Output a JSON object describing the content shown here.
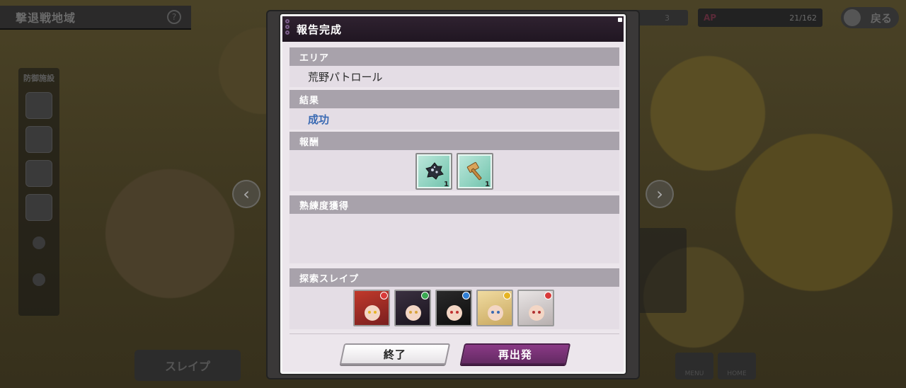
{
  "background": {
    "area_title": "撃退戦地域",
    "defense_label": "防御施設",
    "ap_label": "AP",
    "ap_value": "21/162",
    "back_label": "戻る",
    "search_count": "3",
    "slave_button": "スレイプ",
    "menu_label": "MENU",
    "home_label": "HOME"
  },
  "dialog": {
    "title": "報告完成",
    "sections": {
      "area": {
        "label": "エリア",
        "value": "荒野パトロール"
      },
      "result": {
        "label": "結果",
        "value": "成功"
      },
      "reward": {
        "label": "報酬",
        "items": [
          {
            "icon": "ore-icon",
            "qty": "1"
          },
          {
            "icon": "hammer-icon",
            "qty": "1"
          }
        ]
      },
      "proficiency": {
        "label": "熟練度獲得"
      },
      "slaves": {
        "label": "探索スレイプ",
        "members": [
          {
            "badge_color": "#d83a3a",
            "hair": "#c0392b",
            "eye": "#e6b422"
          },
          {
            "badge_color": "#3aa852",
            "hair": "#2a2230",
            "eye": "#d8a33a"
          },
          {
            "badge_color": "#2f7fd6",
            "hair": "#1a1a1a",
            "eye": "#c03030"
          },
          {
            "badge_color": "#e6b422",
            "hair": "#e8cf8e",
            "eye": "#3a6ab3"
          },
          {
            "badge_color": "#d83a3a",
            "hair": "#d9d4d4",
            "eye": "#b03030"
          }
        ]
      }
    },
    "buttons": {
      "end": "終了",
      "redeploy": "再出発"
    }
  },
  "colors": {
    "header_bg": "#201622",
    "section_head": "#a8a2ab",
    "success_text": "#3a6ab3",
    "primary_button": "#642a63"
  }
}
